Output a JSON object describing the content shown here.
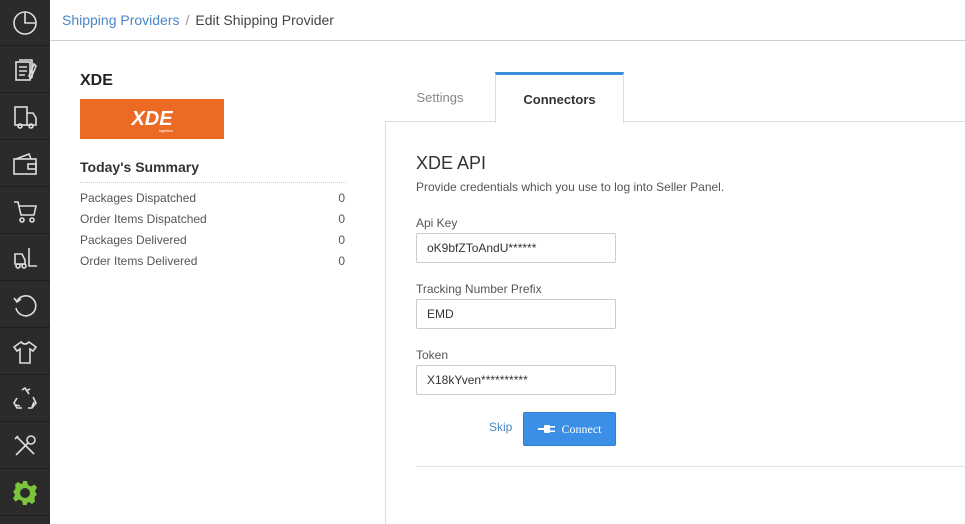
{
  "breadcrumb": {
    "parent": "Shipping Providers",
    "separator": "/",
    "current": "Edit Shipping Provider"
  },
  "sidebar": {
    "items": [
      {
        "icon": "dashboard-icon"
      },
      {
        "icon": "orders-icon"
      },
      {
        "icon": "shipping-truck-icon"
      },
      {
        "icon": "wallet-icon"
      },
      {
        "icon": "cart-icon"
      },
      {
        "icon": "forklift-icon"
      },
      {
        "icon": "returns-icon"
      },
      {
        "icon": "apparel-icon"
      },
      {
        "icon": "recycle-icon"
      },
      {
        "icon": "tools-icon"
      },
      {
        "icon": "settings-gear-icon",
        "active": true
      }
    ],
    "background": "#2b2b2b",
    "active_color": "#7cc43b"
  },
  "provider": {
    "name": "XDE",
    "logo_text": "XDE",
    "logo_color": "#ec6a24"
  },
  "summary": {
    "title": "Today's Summary",
    "rows": [
      {
        "label": "Packages Dispatched",
        "value": "0"
      },
      {
        "label": "Order Items Dispatched",
        "value": "0"
      },
      {
        "label": "Packages Delivered",
        "value": "0"
      },
      {
        "label": "Order Items Delivered",
        "value": "0"
      }
    ]
  },
  "tabs": {
    "settings": "Settings",
    "connectors": "Connectors",
    "active": "connectors"
  },
  "connector": {
    "title": "XDE API",
    "description": "Provide credentials which you use to log into Seller Panel.",
    "fields": [
      {
        "label": "Api Key",
        "value": "oK9bfZToAndU******"
      },
      {
        "label": "Tracking Number Prefix",
        "value": "EMD"
      },
      {
        "label": "Token",
        "value": "X18kYven**********"
      }
    ],
    "skip_label": "Skip",
    "connect_label": "Connect",
    "accent": "#3b8fe6"
  }
}
